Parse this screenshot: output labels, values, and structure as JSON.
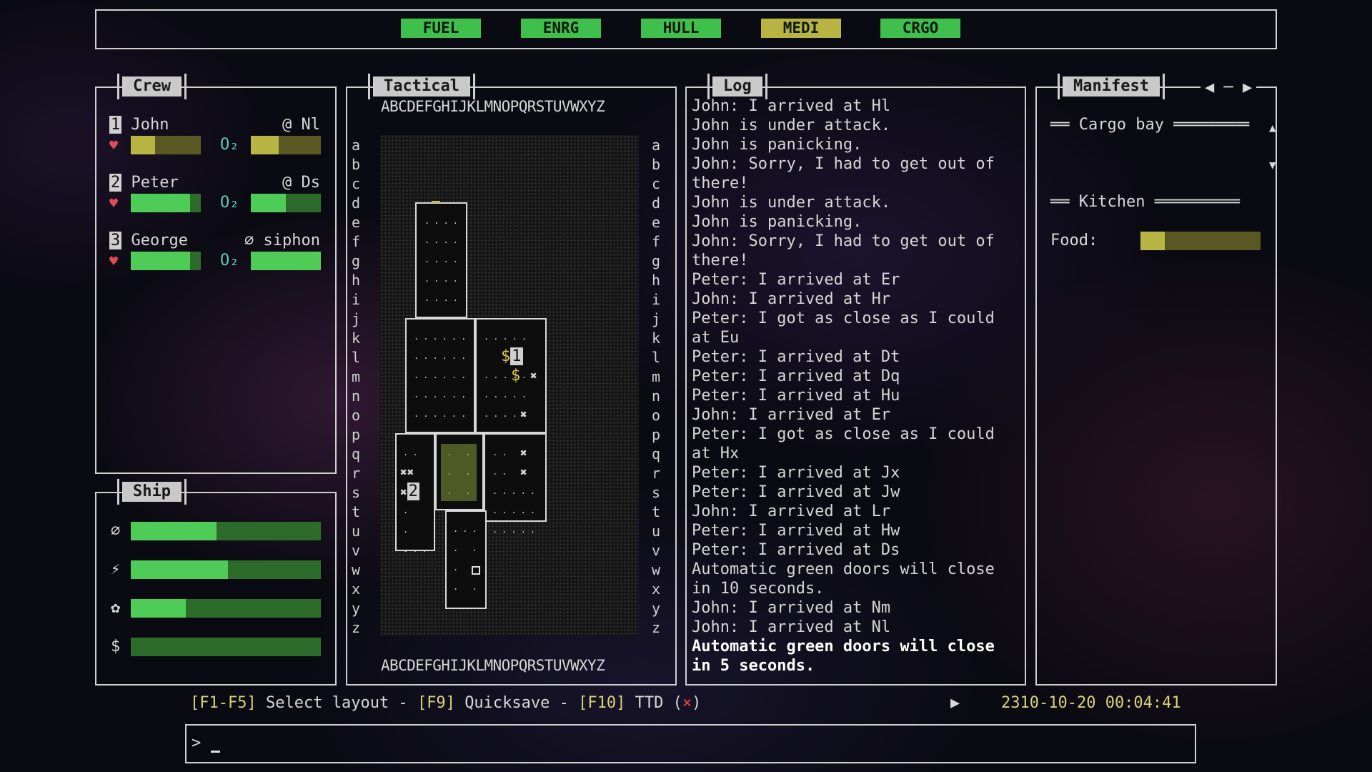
{
  "top_tags": [
    "FUEL",
    "ENRG",
    "HULL",
    "MEDI",
    "CRGO"
  ],
  "crew": {
    "title": "Crew",
    "members": [
      {
        "num": "1",
        "name": "John",
        "loc": "@ Nl",
        "o2": "O₂",
        "health": 0.35,
        "oxygen": 0.4,
        "health_color": "yellow",
        "oxygen_color": "yellow"
      },
      {
        "num": "2",
        "name": "Peter",
        "loc": "@ Ds",
        "o2": "O₂",
        "health": 0.85,
        "oxygen": 0.5,
        "health_color": "green",
        "oxygen_color": "green"
      },
      {
        "num": "3",
        "name": "George",
        "loc": "∅ siphon",
        "o2": "O₂",
        "health": 0.85,
        "oxygen": 1.0,
        "health_color": "green",
        "oxygen_color": "green"
      }
    ]
  },
  "ship": {
    "title": "Ship",
    "stats": [
      {
        "icon": "∅",
        "value": 0.45
      },
      {
        "icon": "⚡",
        "value": 0.51
      },
      {
        "icon": "✿",
        "value": 0.29
      },
      {
        "icon": "$",
        "value": 0.0
      }
    ]
  },
  "tactical": {
    "title": "Tactical",
    "columns": "ABCDEFGHIJKLMNOPQRSTUVWXYZ",
    "rows": [
      "a",
      "b",
      "c",
      "d",
      "e",
      "f",
      "g",
      "h",
      "i",
      "j",
      "k",
      "l",
      "m",
      "n",
      "o",
      "p",
      "q",
      "r",
      "s",
      "t",
      "u",
      "v",
      "w",
      "x",
      "y",
      "z"
    ],
    "markers": {
      "unit1": "1",
      "unit2": "2",
      "dollar": "$",
      "cross": "✖",
      "xx": "✖✖"
    }
  },
  "log": {
    "title": "Log",
    "lines": [
      "John: I arrived at Hl",
      "John is under attack.",
      "John is panicking.",
      "John: Sorry, I had to get out of",
      "there!",
      "John is under attack.",
      "John is panicking.",
      "John: Sorry, I had to get out of",
      "there!",
      "Peter: I arrived at Er",
      "John: I arrived at Hr",
      "Peter: I got as close as I could",
      "at Eu",
      "Peter: I arrived at Dt",
      "Peter: I arrived at Dq",
      "Peter: I arrived at Hu",
      "John: I arrived at Er",
      "Peter: I got as close as I could",
      "at Hx",
      "Peter: I arrived at Jx",
      "Peter: I arrived at Jw",
      "John: I arrived at Lr",
      "Peter: I arrived at Hw",
      "Peter: I arrived at Ds",
      "Automatic green doors will close",
      "in 10 seconds.",
      "John: I arrived at Nm",
      "John: I arrived at Nl"
    ],
    "last_lines": [
      "Automatic green doors will close",
      "in 5 seconds."
    ]
  },
  "manifest": {
    "title": "Manifest",
    "nav": "◀ ─ ▶",
    "sections": [
      "Cargo bay",
      "Kitchen"
    ],
    "food_label": "Food:",
    "food_value": 0.2,
    "scroll_up": "▲",
    "scroll_down": "▼"
  },
  "footer": {
    "keys": [
      {
        "key": "F1",
        "mid": "-",
        "key2": "F5",
        "text": "Select layout"
      },
      {
        "key": "F9",
        "text": "Quicksave"
      },
      {
        "key": "F10",
        "text": "TTD"
      }
    ],
    "ttd_mark": "×",
    "play": "▶",
    "datetime": "2310-10-20 00:04:41",
    "prompt": ">"
  }
}
